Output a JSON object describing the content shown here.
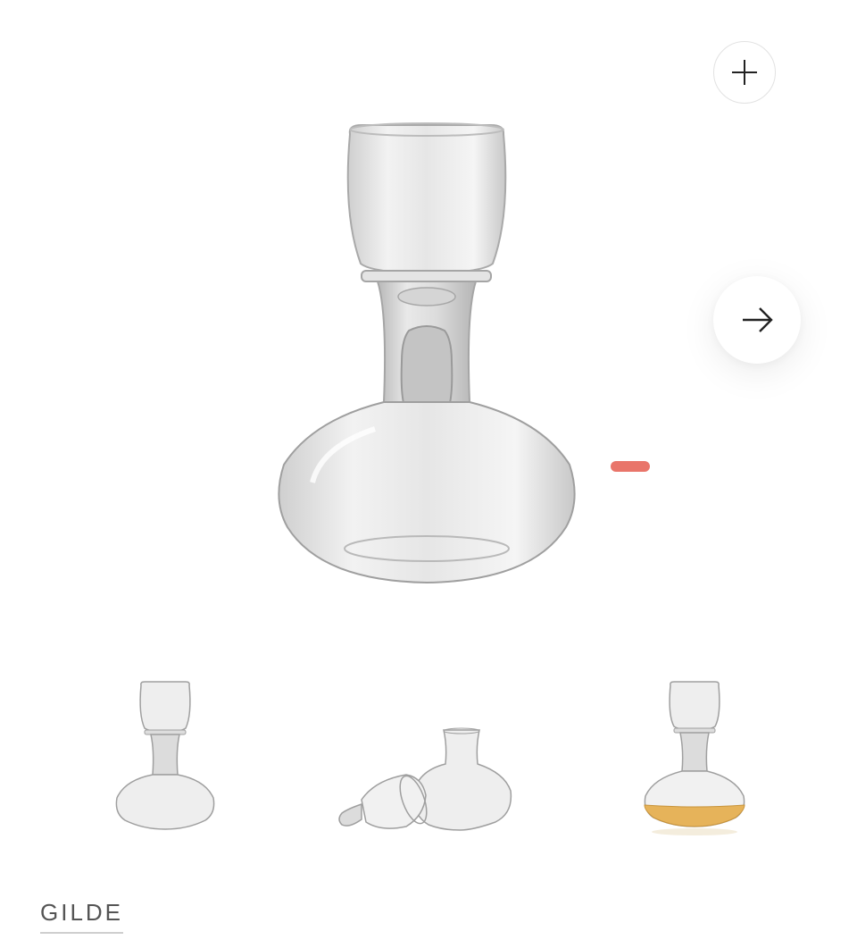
{
  "product": {
    "brand": "GILDE",
    "main_image": {
      "icon": "whiskey-decanter-with-glass"
    }
  },
  "controls": {
    "zoom_icon": "plus-icon",
    "next_icon": "arrow-right-icon"
  },
  "thumbnails": [
    {
      "icon": "decanter-assembled-thumbnail"
    },
    {
      "icon": "decanter-disassembled-thumbnail"
    },
    {
      "icon": "decanter-filled-thumbnail"
    }
  ],
  "colors": {
    "background": "#ffffff",
    "indicator": "#e7665a",
    "liquid": "#e6b35a"
  }
}
